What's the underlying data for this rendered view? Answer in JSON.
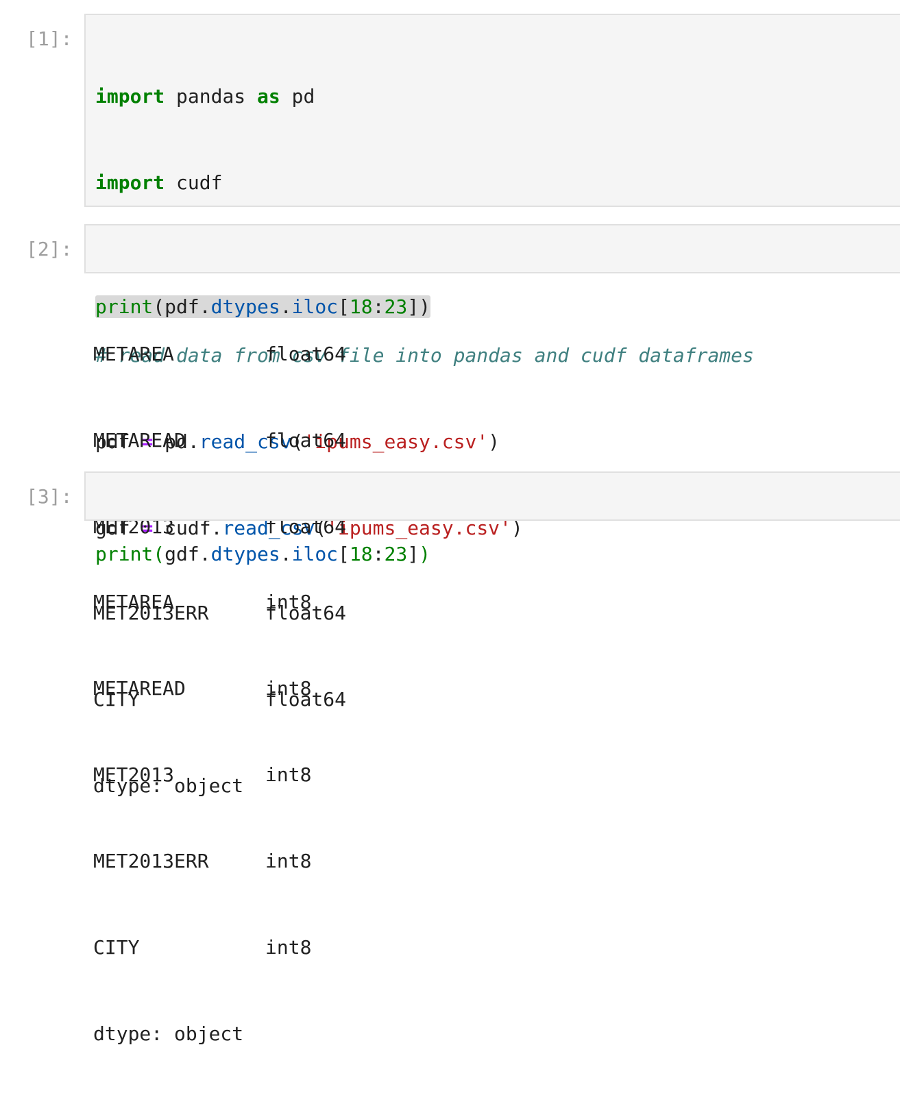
{
  "cells": [
    {
      "prompt": "[1]:",
      "code": {
        "l1_kw1": "import",
        "l1_txt1": " pandas ",
        "l1_kw2": "as",
        "l1_txt2": " pd",
        "l2_kw1": "import",
        "l2_txt1": " cudf",
        "l4_comment": "# read data from csv file into pandas and cudf dataframes",
        "l5_a": "pdf ",
        "l5_op": "=",
        "l5_b": " pd.",
        "l5_fn": "read_csv",
        "l5_p1": "(",
        "l5_str": "'ipums_easy.csv'",
        "l5_p2": ")",
        "l6_a": "gdf ",
        "l6_op": "=",
        "l6_b": " cudf.",
        "l6_fn": "read_csv",
        "l6_p1": "(",
        "l6_str": "'ipums_easy.csv'",
        "l6_p2": ")"
      }
    },
    {
      "prompt": "[2]:",
      "code": {
        "fn": "print",
        "p1": "(",
        "obj": "pdf.",
        "attr1": "dtypes",
        "dot": ".",
        "attr2": "iloc",
        "b1": "[",
        "n1": "18",
        "colon": ":",
        "n2": "23",
        "b2": "]",
        "p2": ")"
      },
      "output": {
        "rows": [
          {
            "name": "METAREA",
            "dtype": "float64"
          },
          {
            "name": "METAREAD",
            "dtype": "float64"
          },
          {
            "name": "MET2013",
            "dtype": "float64"
          },
          {
            "name": "MET2013ERR",
            "dtype": "float64"
          },
          {
            "name": "CITY",
            "dtype": "float64"
          }
        ],
        "footer": "dtype: object"
      }
    },
    {
      "prompt": "[3]:",
      "code": {
        "fn": "print",
        "p1": "(",
        "obj": "gdf.",
        "attr1": "dtypes",
        "dot": ".",
        "attr2": "iloc",
        "b1": "[",
        "n1": "18",
        "colon": ":",
        "n2": "23",
        "b2": "]",
        "p2": ")"
      },
      "output": {
        "rows": [
          {
            "name": "METAREA",
            "dtype": "int8"
          },
          {
            "name": "METAREAD",
            "dtype": "int8"
          },
          {
            "name": "MET2013",
            "dtype": "int8"
          },
          {
            "name": "MET2013ERR",
            "dtype": "int8"
          },
          {
            "name": "CITY",
            "dtype": "int8"
          }
        ],
        "footer": "dtype: object"
      }
    }
  ]
}
